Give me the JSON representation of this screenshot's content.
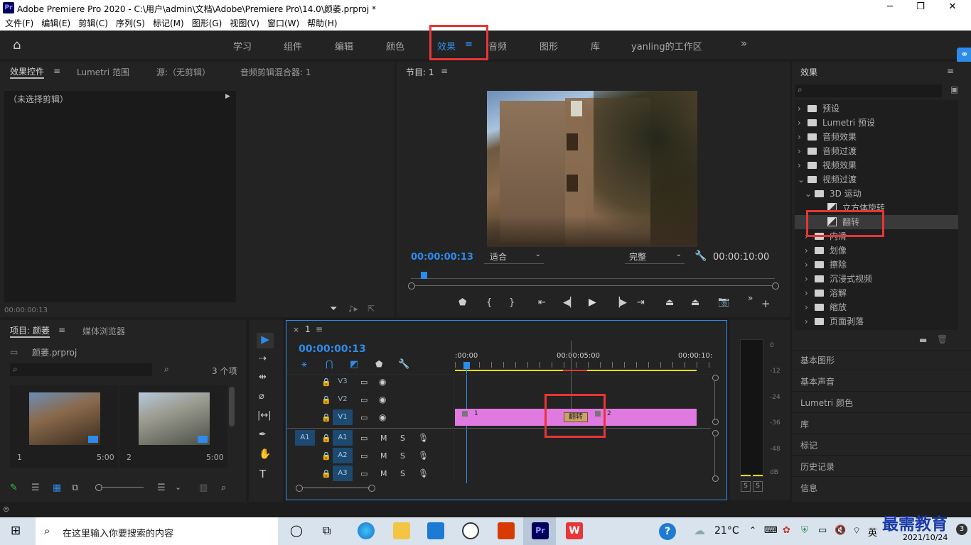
{
  "window": {
    "title": "Adobe Premiere Pro 2020 - C:\\用户\\admin\\文档\\Adobe\\Premiere Pro\\14.0\\颜萎.prproj *",
    "app_icon": "Pr"
  },
  "menu": [
    "文件(F)",
    "编辑(E)",
    "剪辑(C)",
    "序列(S)",
    "标记(M)",
    "图形(G)",
    "视图(V)",
    "窗口(W)",
    "帮助(H)"
  ],
  "workspaces": [
    "学习",
    "组件",
    "编辑",
    "颜色",
    "效果",
    "音频",
    "图形",
    "库",
    "yanling的工作区"
  ],
  "active_workspace": "效果",
  "source_panel": {
    "tabs": [
      "效果控件",
      "Lumetri 范围",
      "源:（无剪辑）",
      "音频剪辑混合器: 1"
    ],
    "no_clip": "（未选择剪辑）",
    "timecode": "00:00:00:13"
  },
  "program": {
    "title": "节目: 1",
    "timecode": "00:00:00:13",
    "fit": "适合",
    "quality": "完整",
    "duration": "00:00:10:00"
  },
  "project": {
    "tabs": [
      "项目: 颜萎",
      "媒体浏览器"
    ],
    "file": "颜萎.prproj",
    "count": "3 个项",
    "clips": [
      {
        "name": "1",
        "duration": "5:00"
      },
      {
        "name": "2",
        "duration": "5:00"
      }
    ]
  },
  "timeline": {
    "sequence": "1",
    "timecode": "00:00:00:13",
    "ruler": [
      ":00:00",
      "00:00:05:00",
      "00:00:10:"
    ],
    "video_tracks": [
      "V3",
      "V2",
      "V1"
    ],
    "audio_tracks": [
      "A1",
      "A2",
      "A3"
    ],
    "source_patch": "A1",
    "clip1_label": "1",
    "clip2_label": "2",
    "transition": "翻转",
    "audio_btns": [
      "M",
      "S"
    ],
    "playhead_fraction": 0.026
  },
  "meter": {
    "scale": [
      "0",
      "-12",
      "-24",
      "-36",
      "-48",
      "dB"
    ],
    "solo": [
      "S",
      "S"
    ]
  },
  "effects": {
    "title": "效果",
    "tree": [
      {
        "label": "预设",
        "level": 0,
        "kind": "folder",
        "open": false
      },
      {
        "label": "Lumetri 预设",
        "level": 0,
        "kind": "folder",
        "open": false
      },
      {
        "label": "音频效果",
        "level": 0,
        "kind": "folder",
        "open": false
      },
      {
        "label": "音频过渡",
        "level": 0,
        "kind": "folder",
        "open": false
      },
      {
        "label": "视频效果",
        "level": 0,
        "kind": "folder",
        "open": false
      },
      {
        "label": "视频过渡",
        "level": 0,
        "kind": "folder",
        "open": true
      },
      {
        "label": "3D 运动",
        "level": 1,
        "kind": "folder",
        "open": true
      },
      {
        "label": "立方体旋转",
        "level": 2,
        "kind": "fx",
        "open": false
      },
      {
        "label": "翻转",
        "level": 2,
        "kind": "fx",
        "open": false,
        "selected": true
      },
      {
        "label": "内滑",
        "level": 1,
        "kind": "folder",
        "open": false
      },
      {
        "label": "划像",
        "level": 1,
        "kind": "folder",
        "open": false
      },
      {
        "label": "擦除",
        "level": 1,
        "kind": "folder",
        "open": false
      },
      {
        "label": "沉浸式视频",
        "level": 1,
        "kind": "folder",
        "open": false
      },
      {
        "label": "溶解",
        "level": 1,
        "kind": "folder",
        "open": false
      },
      {
        "label": "缩放",
        "level": 1,
        "kind": "folder",
        "open": false
      },
      {
        "label": "页面剥落",
        "level": 1,
        "kind": "folder",
        "open": false
      }
    ],
    "other_panels": [
      "基本图形",
      "基本声音",
      "Lumetri 颜色",
      "库",
      "标记",
      "历史记录",
      "信息"
    ]
  },
  "taskbar": {
    "search_placeholder": "在这里输入你要搜索的内容",
    "weather": "21°C",
    "ime": "英",
    "date": "2021/10/24",
    "watermark": "最需教育"
  },
  "colors": {
    "accent": "#2d8ceb",
    "clip": "#e07ae0",
    "highlight": "#e83535",
    "transition": "#c9a46a"
  }
}
